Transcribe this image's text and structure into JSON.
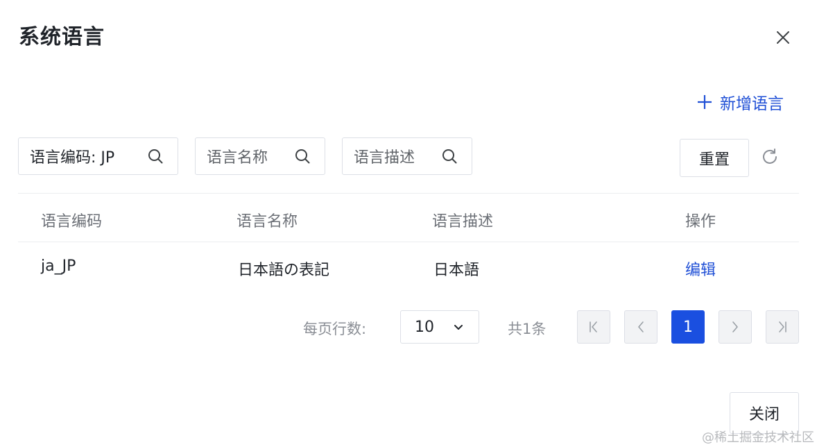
{
  "dialog": {
    "title": "系统语言",
    "add_button_label": "新增语言",
    "close_button_label": "关闭"
  },
  "filters": {
    "code": {
      "value": "语言编码: JP"
    },
    "name": {
      "placeholder": "语言名称"
    },
    "description": {
      "placeholder": "语言描述"
    },
    "reset_label": "重置"
  },
  "table": {
    "columns": [
      "语言编码",
      "语言名称",
      "语言描述",
      "操作"
    ],
    "rows": [
      {
        "code": "ja_JP",
        "name": "日本語の表記",
        "description": "日本語",
        "action": "编辑"
      }
    ]
  },
  "pagination": {
    "page_size_label": "每页行数:",
    "page_size": "10",
    "total_label": "共1条",
    "current_page": "1"
  },
  "watermark": "@稀土掘金技术社区",
  "colors": {
    "accent": "#1f4fd6",
    "active_page": "#1a4fe0",
    "border": "#dcdfe6",
    "muted_text": "#6b6f76"
  },
  "icons": [
    "close-icon",
    "plus-icon",
    "search-icon",
    "refresh-icon",
    "chevron-down-icon",
    "first-page-icon",
    "prev-page-icon",
    "next-page-icon",
    "last-page-icon"
  ]
}
